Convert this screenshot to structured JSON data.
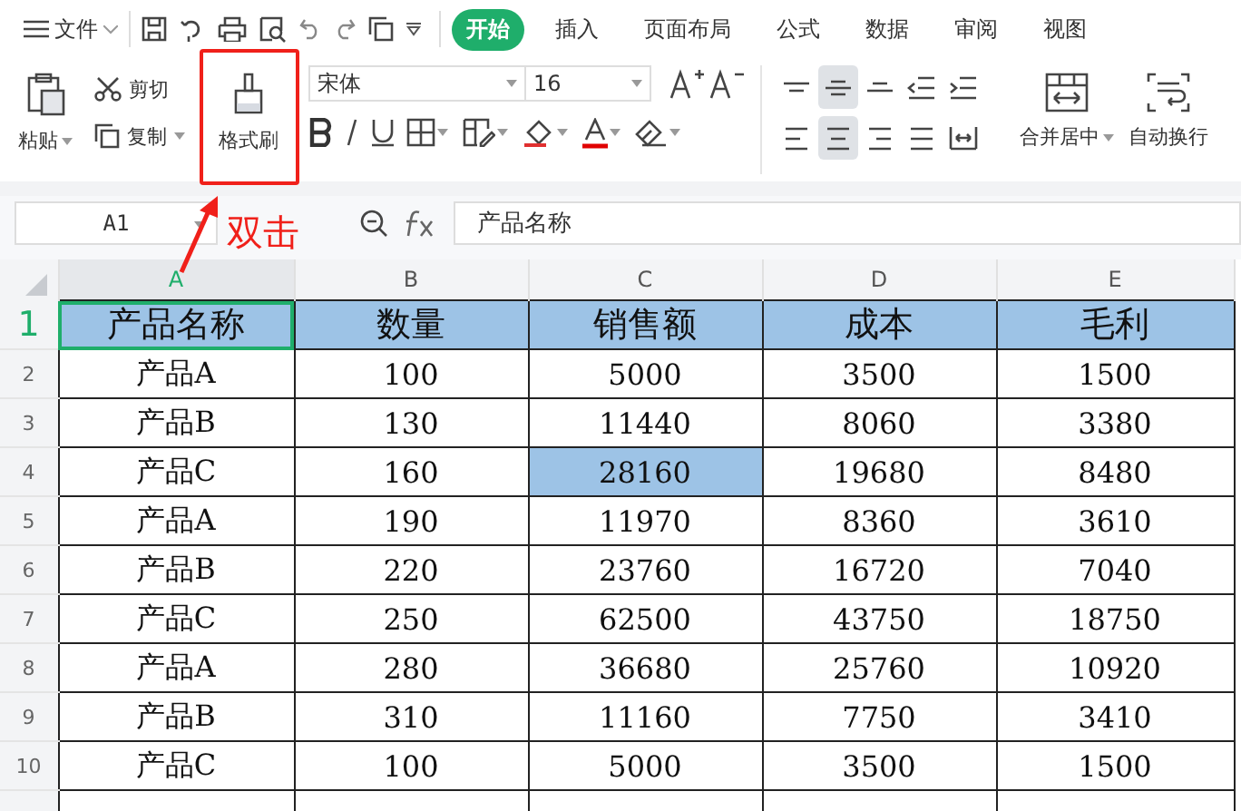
{
  "menu": {
    "label": "文件"
  },
  "tabs": [
    {
      "label": "开始",
      "selected": true
    },
    {
      "label": "插入",
      "selected": false
    },
    {
      "label": "页面布局",
      "selected": false
    },
    {
      "label": "公式",
      "selected": false
    },
    {
      "label": "数据",
      "selected": false
    },
    {
      "label": "审阅",
      "selected": false
    },
    {
      "label": "视图",
      "selected": false
    }
  ],
  "clipboard": {
    "paste": "粘贴",
    "cut": "剪切",
    "copy": "复制",
    "format_painter": "格式刷"
  },
  "font": {
    "name": "宋体",
    "size": "16"
  },
  "alignment": [
    {
      "selected": false
    },
    {
      "selected": true
    },
    {
      "selected": false
    },
    {
      "selected": false
    },
    {
      "selected": false
    },
    {
      "selected": false
    },
    {
      "selected": true
    },
    {
      "selected": false
    },
    {
      "selected": false
    },
    {
      "selected": false
    }
  ],
  "merge_button": "合并居中",
  "wrap_button": "自动换行",
  "name_box": "A1",
  "formula": "产品名称",
  "annotation": {
    "label": "双击"
  },
  "columns": [
    {
      "label": "A",
      "selected": true
    },
    {
      "label": "B",
      "selected": false
    },
    {
      "label": "C",
      "selected": false
    },
    {
      "label": "D",
      "selected": false
    },
    {
      "label": "E",
      "selected": false
    }
  ],
  "rows": [
    {
      "number": "1",
      "kind": "header",
      "selected": true,
      "cells": [
        {
          "text": "产品名称",
          "highlighted": true,
          "selected": true
        },
        {
          "text": "数量",
          "highlighted": true,
          "selected": false
        },
        {
          "text": "销售额",
          "highlighted": true,
          "selected": false
        },
        {
          "text": "成本",
          "highlighted": true,
          "selected": false
        },
        {
          "text": "毛利",
          "highlighted": true,
          "selected": false
        }
      ]
    },
    {
      "number": "2",
      "kind": "data",
      "selected": false,
      "cells": [
        {
          "text": "产品A",
          "highlighted": false,
          "selected": false
        },
        {
          "text": "100",
          "highlighted": false,
          "selected": false
        },
        {
          "text": "5000",
          "highlighted": false,
          "selected": false
        },
        {
          "text": "3500",
          "highlighted": false,
          "selected": false
        },
        {
          "text": "1500",
          "highlighted": false,
          "selected": false
        }
      ]
    },
    {
      "number": "3",
      "kind": "data",
      "selected": false,
      "cells": [
        {
          "text": "产品B",
          "highlighted": false,
          "selected": false
        },
        {
          "text": "130",
          "highlighted": false,
          "selected": false
        },
        {
          "text": "11440",
          "highlighted": false,
          "selected": false
        },
        {
          "text": "8060",
          "highlighted": false,
          "selected": false
        },
        {
          "text": "3380",
          "highlighted": false,
          "selected": false
        }
      ]
    },
    {
      "number": "4",
      "kind": "data",
      "selected": false,
      "cells": [
        {
          "text": "产品C",
          "highlighted": false,
          "selected": false
        },
        {
          "text": "160",
          "highlighted": false,
          "selected": false
        },
        {
          "text": "28160",
          "highlighted": true,
          "selected": false
        },
        {
          "text": "19680",
          "highlighted": false,
          "selected": false
        },
        {
          "text": "8480",
          "highlighted": false,
          "selected": false
        }
      ]
    },
    {
      "number": "5",
      "kind": "data",
      "selected": false,
      "cells": [
        {
          "text": "产品A",
          "highlighted": false,
          "selected": false
        },
        {
          "text": "190",
          "highlighted": false,
          "selected": false
        },
        {
          "text": "11970",
          "highlighted": false,
          "selected": false
        },
        {
          "text": "8360",
          "highlighted": false,
          "selected": false
        },
        {
          "text": "3610",
          "highlighted": false,
          "selected": false
        }
      ]
    },
    {
      "number": "6",
      "kind": "data",
      "selected": false,
      "cells": [
        {
          "text": "产品B",
          "highlighted": false,
          "selected": false
        },
        {
          "text": "220",
          "highlighted": false,
          "selected": false
        },
        {
          "text": "23760",
          "highlighted": false,
          "selected": false
        },
        {
          "text": "16720",
          "highlighted": false,
          "selected": false
        },
        {
          "text": "7040",
          "highlighted": false,
          "selected": false
        }
      ]
    },
    {
      "number": "7",
      "kind": "data",
      "selected": false,
      "cells": [
        {
          "text": "产品C",
          "highlighted": false,
          "selected": false
        },
        {
          "text": "250",
          "highlighted": false,
          "selected": false
        },
        {
          "text": "62500",
          "highlighted": false,
          "selected": false
        },
        {
          "text": "43750",
          "highlighted": false,
          "selected": false
        },
        {
          "text": "18750",
          "highlighted": false,
          "selected": false
        }
      ]
    },
    {
      "number": "8",
      "kind": "data",
      "selected": false,
      "cells": [
        {
          "text": "产品A",
          "highlighted": false,
          "selected": false
        },
        {
          "text": "280",
          "highlighted": false,
          "selected": false
        },
        {
          "text": "36680",
          "highlighted": false,
          "selected": false
        },
        {
          "text": "25760",
          "highlighted": false,
          "selected": false
        },
        {
          "text": "10920",
          "highlighted": false,
          "selected": false
        }
      ]
    },
    {
      "number": "9",
      "kind": "data",
      "selected": false,
      "cells": [
        {
          "text": "产品B",
          "highlighted": false,
          "selected": false
        },
        {
          "text": "310",
          "highlighted": false,
          "selected": false
        },
        {
          "text": "11160",
          "highlighted": false,
          "selected": false
        },
        {
          "text": "7750",
          "highlighted": false,
          "selected": false
        },
        {
          "text": "3410",
          "highlighted": false,
          "selected": false
        }
      ]
    },
    {
      "number": "10",
      "kind": "data",
      "selected": false,
      "cells": [
        {
          "text": "产品C",
          "highlighted": false,
          "selected": false
        },
        {
          "text": "100",
          "highlighted": false,
          "selected": false
        },
        {
          "text": "5000",
          "highlighted": false,
          "selected": false
        },
        {
          "text": "3500",
          "highlighted": false,
          "selected": false
        },
        {
          "text": "1500",
          "highlighted": false,
          "selected": false
        }
      ]
    }
  ]
}
